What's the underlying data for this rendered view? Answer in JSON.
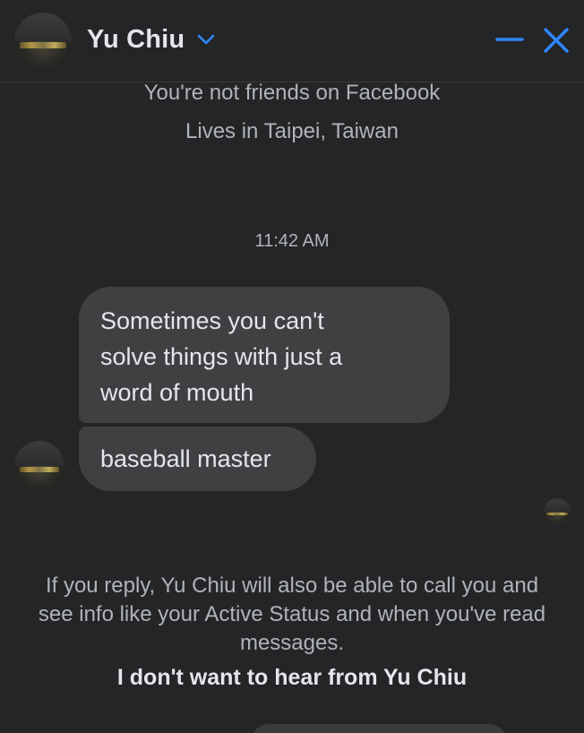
{
  "header": {
    "contact_name": "Yu Chiu",
    "icons": {
      "dropdown": "chevron-down-icon",
      "minimize": "minimize-icon",
      "close": "close-icon"
    },
    "accent_color": "#2d88ff"
  },
  "profile_info": {
    "friendship": "You're not friends on Facebook",
    "location": "Lives in Taipei, Taiwan"
  },
  "conversation": {
    "timestamp": "11:42 AM",
    "messages": [
      {
        "text": "Sometimes you can't\nsolve things with just a\nword of mouth"
      },
      {
        "text": "baseball master"
      }
    ]
  },
  "notice": {
    "text": "If you reply, Yu Chiu will also be able to call you and see info like your Active Status and when you've read messages.",
    "block_action": "I don't want to hear from Yu Chiu"
  },
  "colors": {
    "background": "#242526",
    "bubble": "#3e4042",
    "primary_text": "#e4e6eb",
    "secondary_text": "#b0b3b8"
  }
}
